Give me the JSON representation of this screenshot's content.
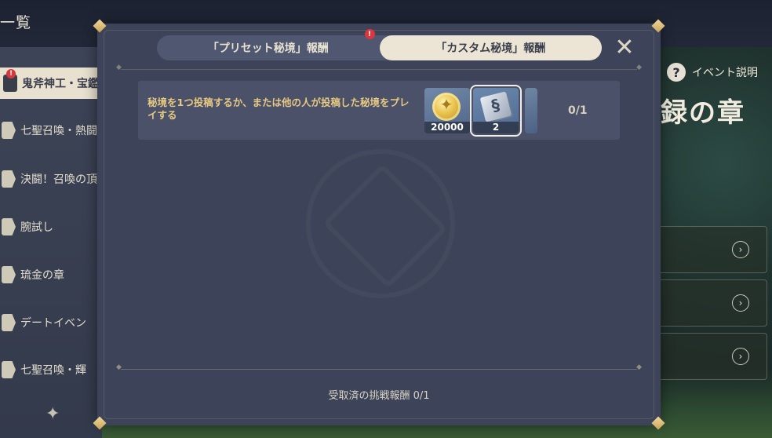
{
  "background": {
    "page_title": "一覧",
    "event_help_label": "イベント説明",
    "event_title": "録の章",
    "cards": [
      {
        "arrow": "›"
      },
      {
        "arrow": "›"
      },
      {
        "arrow": "›"
      }
    ]
  },
  "sidebar": {
    "items": [
      {
        "label": "鬼斧神工・宝鑑",
        "active": true,
        "badge": "!"
      },
      {
        "label": "七聖召喚・熱闘"
      },
      {
        "label": "決闘！召喚の頂"
      },
      {
        "label": "腕試し"
      },
      {
        "label": "琉金の章"
      },
      {
        "label": "デートイベン"
      },
      {
        "label": "七聖召喚・輝"
      }
    ],
    "star": "✦"
  },
  "modal": {
    "tabs": [
      {
        "label": "「プリセット秘境」報酬",
        "badge": "!"
      },
      {
        "label": "「カスタム秘境」報酬",
        "selected": true
      }
    ],
    "close_symbol": "✕",
    "task": {
      "description": "秘境を1つ投稿するか、または他の人が投稿した秘境をプレイする",
      "rewards": [
        {
          "icon": "mora-coin-icon",
          "count": "20000"
        },
        {
          "icon": "book-item-icon",
          "count": "2"
        }
      ],
      "progress": "0/1"
    },
    "claimed_text": "受取済の挑戦報酬 0/1"
  }
}
